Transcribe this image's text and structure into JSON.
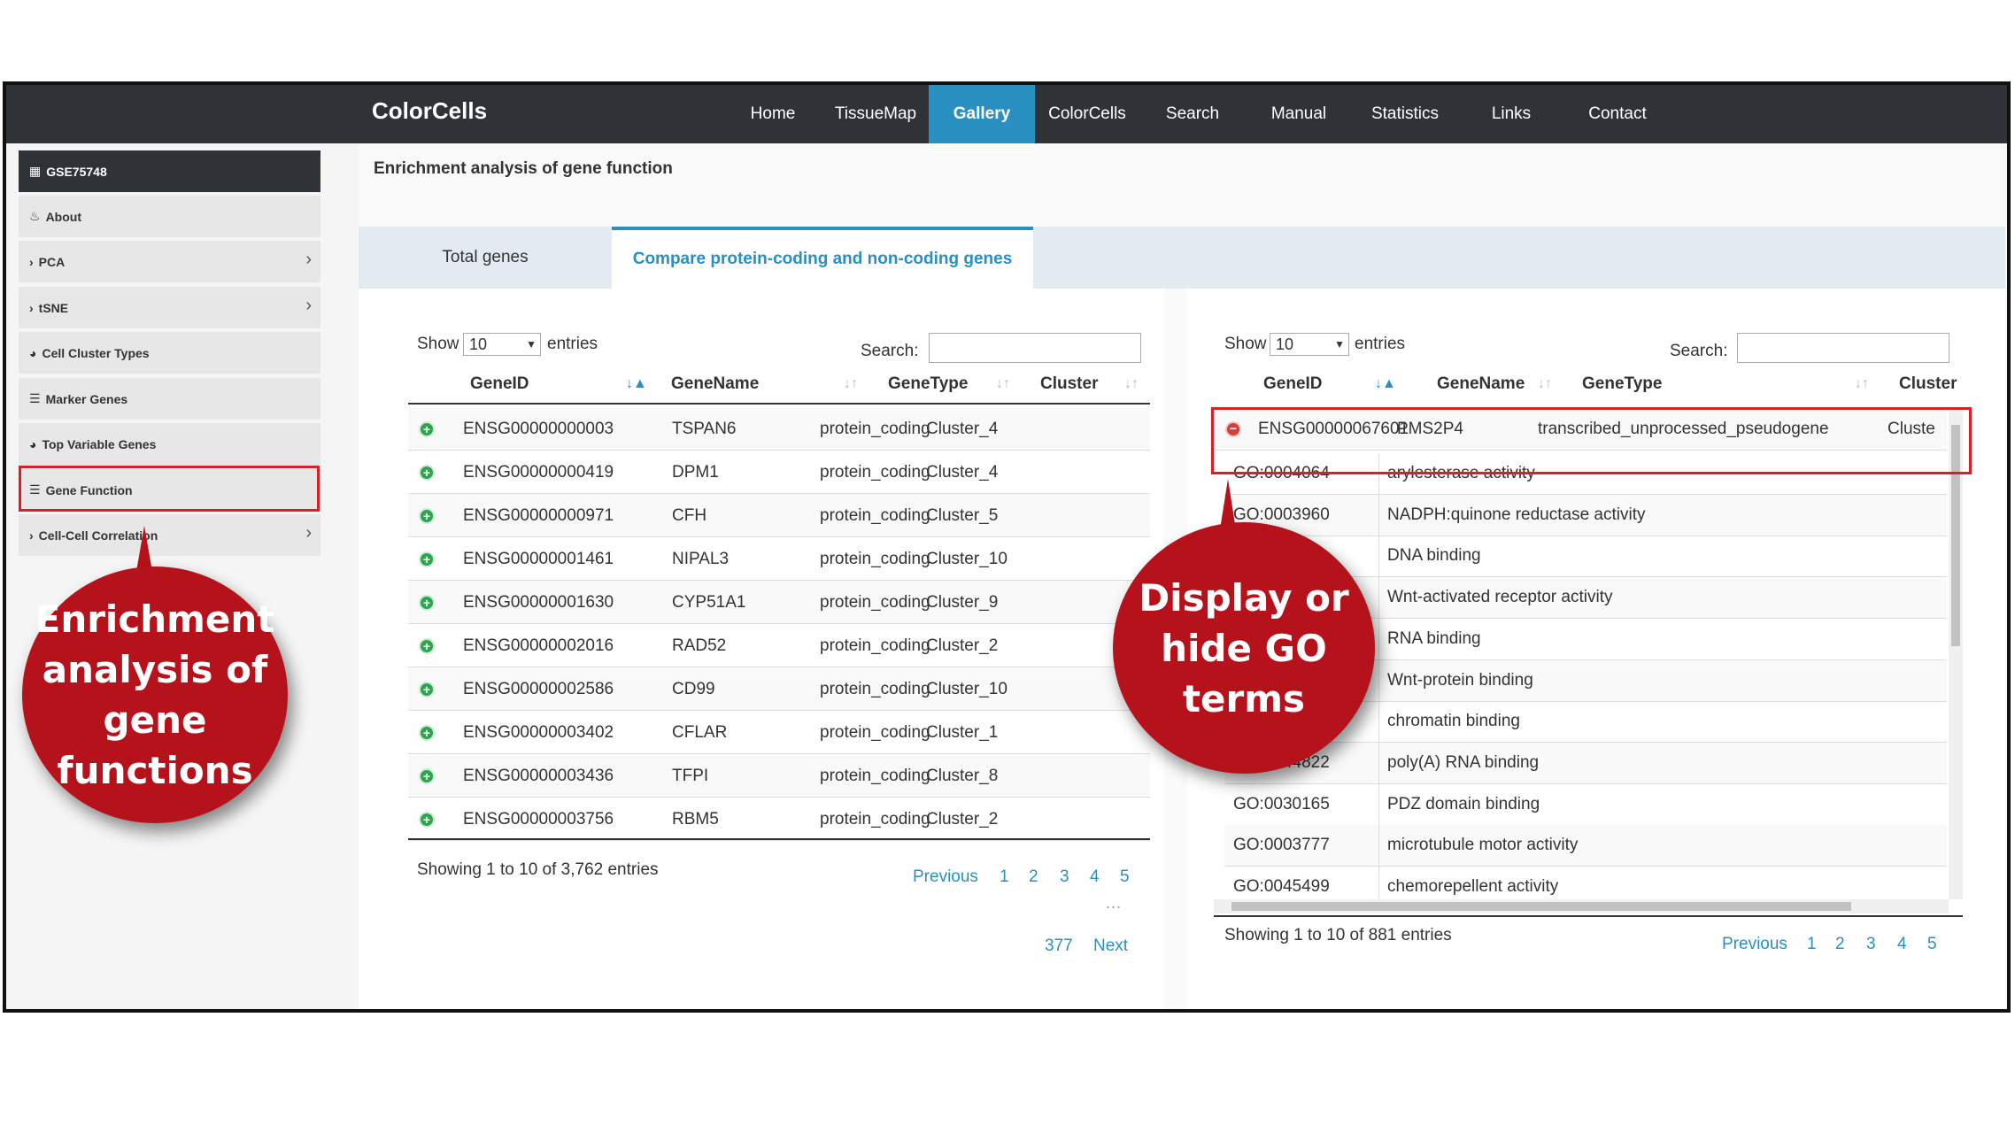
{
  "navbar": {
    "brand": "ColorCells",
    "items": [
      "Home",
      "TissueMap",
      "Gallery",
      "ColorCells",
      "Search",
      "Manual",
      "Statistics",
      "Links",
      "Contact"
    ],
    "active": "Gallery"
  },
  "sidebar": {
    "dataset": "GSE75748",
    "items": [
      {
        "label": "About",
        "icon": "fire-icon"
      },
      {
        "label": "PCA",
        "icon": "chevron-right-icon"
      },
      {
        "label": "tSNE",
        "icon": "chevron-right-icon"
      },
      {
        "label": "Cell Cluster Types",
        "icon": "globe-icon"
      },
      {
        "label": "Marker Genes",
        "icon": "list-icon"
      },
      {
        "label": "Top Variable Genes",
        "icon": "globe-icon"
      },
      {
        "label": "Gene Function",
        "icon": "list-icon"
      },
      {
        "label": "Cell-Cell Correlation",
        "icon": "chevron-right-icon"
      }
    ]
  },
  "main": {
    "title": "Enrichment analysis of gene function",
    "tabs": [
      "Total genes",
      "Compare protein-coding and non-coding genes"
    ],
    "active_tab": "Compare protein-coding and non-coding genes"
  },
  "left_table": {
    "show_label": "Show",
    "entries_value": "10",
    "entries_label": "entries",
    "search_label": "Search:",
    "columns": [
      "GeneID",
      "GeneName",
      "GeneType",
      "Cluster"
    ],
    "rows": [
      [
        "ENSG00000000003",
        "TSPAN6",
        "protein_coding",
        "Cluster_4"
      ],
      [
        "ENSG00000000419",
        "DPM1",
        "protein_coding",
        "Cluster_4"
      ],
      [
        "ENSG00000000971",
        "CFH",
        "protein_coding",
        "Cluster_5"
      ],
      [
        "ENSG00000001461",
        "NIPAL3",
        "protein_coding",
        "Cluster_10"
      ],
      [
        "ENSG00000001630",
        "CYP51A1",
        "protein_coding",
        "Cluster_9"
      ],
      [
        "ENSG00000002016",
        "RAD52",
        "protein_coding",
        "Cluster_2"
      ],
      [
        "ENSG00000002586",
        "CD99",
        "protein_coding",
        "Cluster_10"
      ],
      [
        "ENSG00000003402",
        "CFLAR",
        "protein_coding",
        "Cluster_1"
      ],
      [
        "ENSG00000003436",
        "TFPI",
        "protein_coding",
        "Cluster_8"
      ],
      [
        "ENSG00000003756",
        "RBM5",
        "protein_coding",
        "Cluster_2"
      ]
    ],
    "info": "Showing 1 to 10 of 3,762 entries",
    "pagination": {
      "previous": "Previous",
      "pages": [
        "1",
        "2",
        "3",
        "4",
        "5"
      ],
      "ellipsis": "…",
      "last": "377",
      "next": "Next"
    }
  },
  "right_table": {
    "show_label": "Show",
    "entries_value": "10",
    "entries_label": "entries",
    "search_label": "Search:",
    "columns": [
      "GeneID",
      "GeneName",
      "GeneType",
      "Cluster"
    ],
    "expanded_row": [
      "ENSG00000067601",
      "PMS2P4",
      "transcribed_unprocessed_pseudogene",
      "Cluste"
    ],
    "go_terms": [
      [
        "GO:0004064",
        "arylesterase activity"
      ],
      [
        "GO:0003960",
        "NADPH:quinone reductase activity"
      ],
      [
        "",
        "DNA binding"
      ],
      [
        "",
        "Wnt-activated receptor activity"
      ],
      [
        "",
        "RNA binding"
      ],
      [
        "",
        "Wnt-protein binding"
      ],
      [
        "",
        "chromatin binding"
      ],
      [
        "GO:0044822",
        "poly(A) RNA binding"
      ],
      [
        "GO:0030165",
        "PDZ domain binding"
      ],
      [
        "GO:0003777",
        "microtubule motor activity"
      ],
      [
        "GO:0045499",
        "chemorepellent activity"
      ]
    ],
    "info": "Showing 1 to 10 of 881 entries",
    "pagination": {
      "previous": "Previous",
      "pages": [
        "1",
        "2",
        "3",
        "4",
        "5"
      ]
    }
  },
  "callouts": {
    "left": [
      "Enrichment",
      "analysis of",
      "gene functions"
    ],
    "right": [
      "Display or",
      "hide GO terms"
    ]
  },
  "colors": {
    "accent": "#2a8fc1",
    "navbar": "#2f3337",
    "callout": "#b5121b",
    "highlight": "#d92027"
  }
}
